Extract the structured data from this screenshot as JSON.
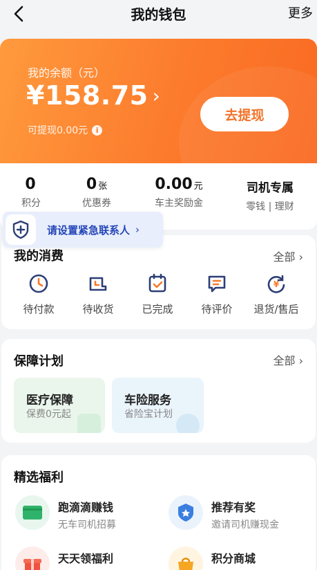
{
  "header": {
    "title": "我的钱包",
    "more_label": "更多"
  },
  "balance": {
    "label": "我的余额（元）",
    "amount": "¥158.75",
    "withdrawable": "可提现0.00元",
    "withdraw_button": "去提现"
  },
  "stats": [
    {
      "value": "0",
      "unit": "",
      "label": "积分"
    },
    {
      "value": "0",
      "unit": "张",
      "label": "优惠券"
    },
    {
      "value": "0.00",
      "unit": "元",
      "label": "车主奖励金"
    },
    {
      "value": "司机专属",
      "unit": "",
      "label": "零钱 | 理财"
    }
  ],
  "emergency": {
    "text": "请设置紧急联系人"
  },
  "orders": {
    "title": "我的消费",
    "all_label": "全部",
    "items": [
      {
        "label": "待付款",
        "icon": "clock-icon"
      },
      {
        "label": "待收货",
        "icon": "delivery-icon"
      },
      {
        "label": "已完成",
        "icon": "calendar-check-icon"
      },
      {
        "label": "待评价",
        "icon": "comment-icon"
      },
      {
        "label": "退货/售后",
        "icon": "refund-icon"
      }
    ]
  },
  "insurance": {
    "title": "保障计划",
    "all_label": "全部",
    "items": [
      {
        "title": "医疗保障",
        "subtitle": "保费0元起"
      },
      {
        "title": "车险服务",
        "subtitle": "省险宝计划"
      }
    ]
  },
  "welfare": {
    "title": "精选福利",
    "items": [
      {
        "title": "跑滴滴赚钱",
        "subtitle": "无车司机招募"
      },
      {
        "title": "推荐有奖",
        "subtitle": "邀请司机赚现金"
      },
      {
        "title": "天天领福利",
        "subtitle": ""
      },
      {
        "title": "积分商城",
        "subtitle": ""
      }
    ]
  },
  "colors": {
    "accent": "#f77a2a",
    "link_blue": "#2446b8",
    "icon_navy": "#2c3e75"
  }
}
